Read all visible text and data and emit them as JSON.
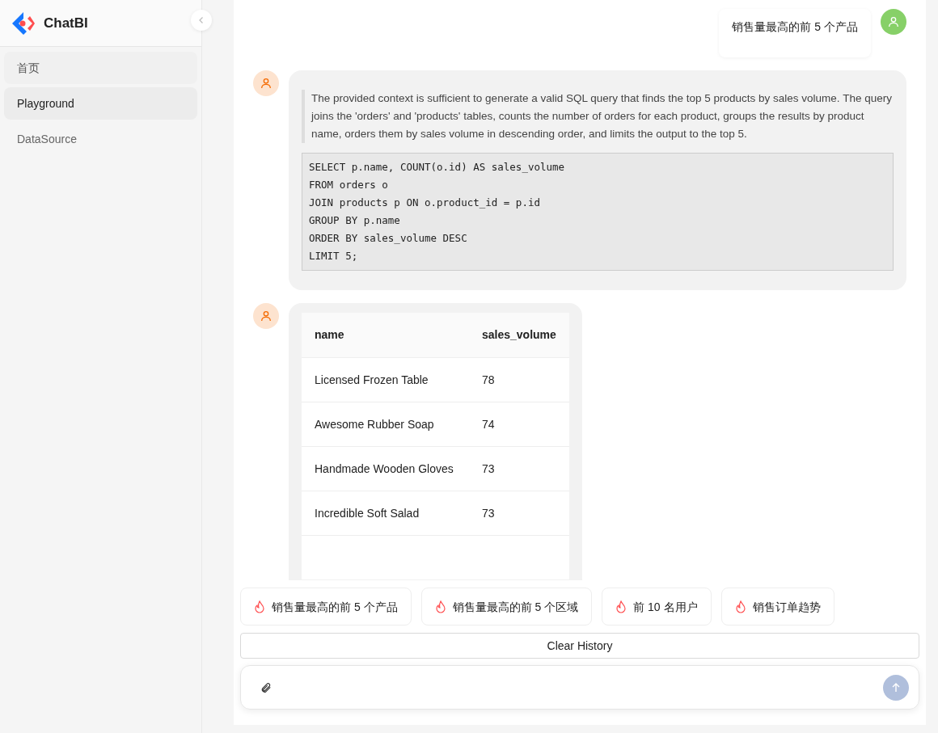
{
  "sidebar": {
    "brand": "ChatBI",
    "items": [
      {
        "label": "首页",
        "selected": false,
        "hovered": true
      },
      {
        "label": "Playground",
        "selected": true,
        "hovered": false
      },
      {
        "label": "DataSource",
        "selected": false,
        "hovered": false
      }
    ]
  },
  "messages": [
    {
      "kind": "user",
      "text": "销售量最高的前 5 个产品"
    },
    {
      "kind": "sql",
      "explanation": "The provided context is sufficient to generate a valid SQL query that finds the top 5 products by sales volume. The query joins the 'orders' and 'products' tables, counts the number of orders for each product, groups the results by product name, orders them by sales volume in descending order, and limits the output to the top 5.",
      "code": [
        "SELECT p.name, COUNT(o.id) AS sales_volume",
        "FROM orders o",
        "JOIN products p ON o.product_id = p.id",
        "GROUP BY p.name",
        "ORDER BY sales_volume DESC",
        "LIMIT 5;"
      ]
    },
    {
      "kind": "table",
      "columns": [
        "name",
        "sales_volume"
      ],
      "rows": [
        [
          "Licensed Frozen Table",
          "78"
        ],
        [
          "Awesome Rubber Soap",
          "74"
        ],
        [
          "Handmade Wooden Gloves",
          "73"
        ],
        [
          "Incredible Soft Salad",
          "73"
        ]
      ]
    }
  ],
  "suggestions": [
    "销售量最高的前 5 个产品",
    "销售量最高的前 5 个区域",
    "前 10 名用户",
    "销售订单趋势"
  ],
  "clear_button": "Clear History"
}
